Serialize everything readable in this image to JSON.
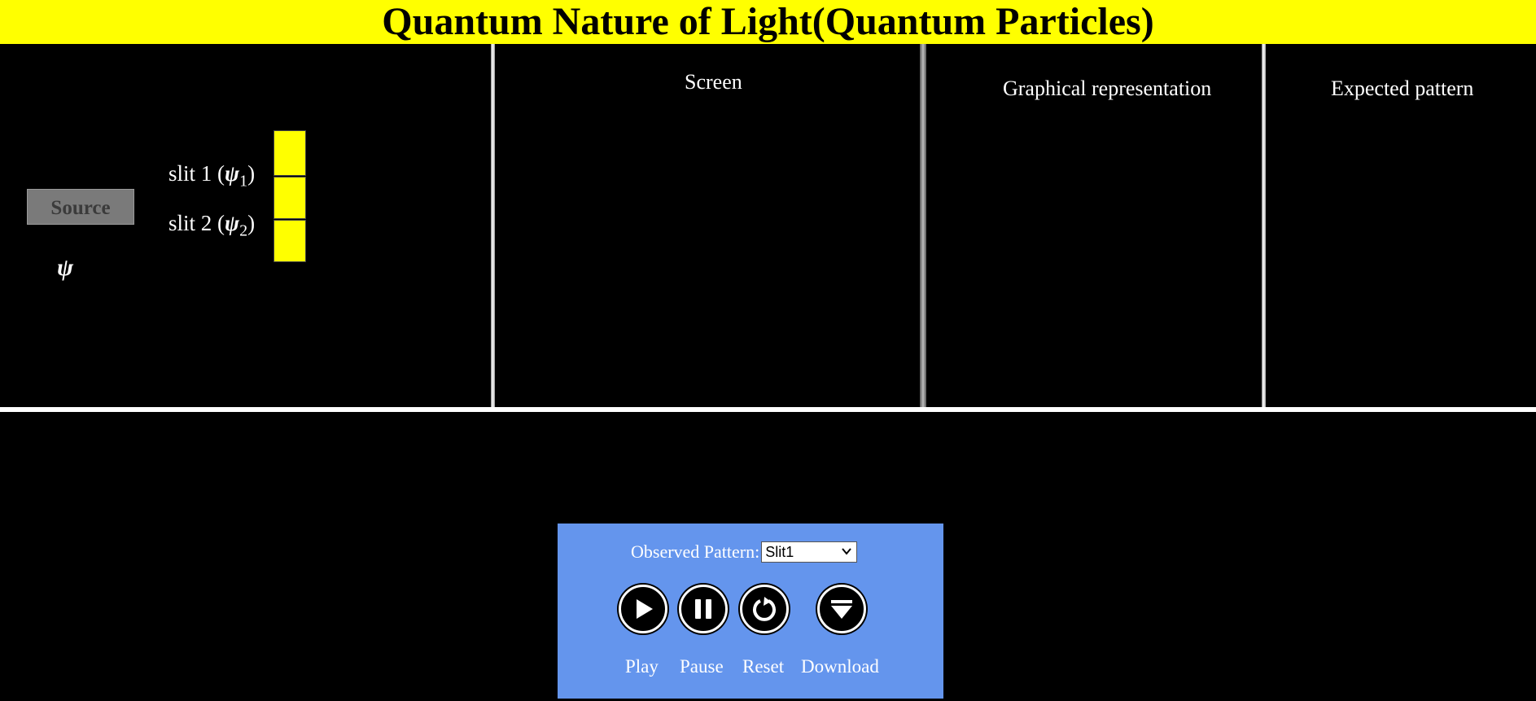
{
  "header": {
    "title": "Quantum Nature of Light(Quantum Particles)"
  },
  "experiment": {
    "source_label": "Source",
    "psi_symbol": "ψ",
    "slit1": {
      "prefix": "slit 1 (",
      "symbol": "ψ",
      "sub": "1",
      "suffix": ")"
    },
    "slit2": {
      "prefix": "slit 2 (",
      "symbol": "ψ",
      "sub": "2",
      "suffix": ")"
    },
    "barrier_color": "#ffff00"
  },
  "panels": {
    "screen_label": "Screen",
    "graph_label": "Graphical representation",
    "expected_label": "Expected pattern"
  },
  "controls": {
    "pattern_label": "Observed Pattern:",
    "pattern_value": "Slit1",
    "play_label": "Play",
    "pause_label": "Pause",
    "reset_label": "Reset",
    "download_label": "Download",
    "panel_color": "#6495ed"
  },
  "icons": {
    "play": "play-icon",
    "pause": "pause-icon",
    "reset": "reset-icon",
    "download": "download-icon",
    "dropdown": "chevron-down-icon"
  }
}
